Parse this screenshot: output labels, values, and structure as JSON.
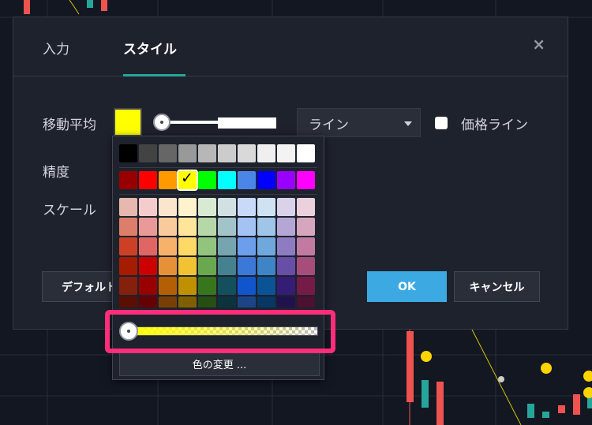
{
  "tabs": [
    {
      "label": "入力"
    },
    {
      "label": "スタイル"
    }
  ],
  "close_label": "×",
  "rows": {
    "moving_average": "移動平均",
    "precision": "精度",
    "scale": "スケール"
  },
  "line_style": {
    "selected": "ライン"
  },
  "price_line": {
    "label": "価格ライン",
    "checked": false
  },
  "buttons": {
    "default": "デフォルト",
    "ok": "OK",
    "cancel": "キャンセル"
  },
  "color_picker": {
    "selected_color": "#ffff00",
    "opacity": 1.0,
    "change_color_label": "色の変更 ...",
    "grays": [
      "#000000",
      "#434343",
      "#666666",
      "#999999",
      "#b7b7b7",
      "#cccccc",
      "#d9d9d9",
      "#efefef",
      "#f3f3f3",
      "#ffffff"
    ],
    "brights": [
      "#980000",
      "#ff0000",
      "#ff9900",
      "#ffff00",
      "#00ff00",
      "#00ffff",
      "#4a86e8",
      "#0000ff",
      "#9900ff",
      "#ff00ff"
    ],
    "shades": [
      [
        "#e6b8af",
        "#f4cccc",
        "#fce5cd",
        "#fff2cc",
        "#d9ead3",
        "#d0e0e3",
        "#c9daf8",
        "#cfe2f3",
        "#d9d2e9",
        "#ead1dc"
      ],
      [
        "#dd7e6b",
        "#ea9999",
        "#f9cb9c",
        "#ffe599",
        "#b6d7a8",
        "#a2c4c9",
        "#a4c2f4",
        "#9fc5e8",
        "#b4a7d6",
        "#d5a6bd"
      ],
      [
        "#cc4125",
        "#e06666",
        "#f6b26b",
        "#ffd966",
        "#93c47d",
        "#76a5af",
        "#6d9eeb",
        "#6fa8dc",
        "#8e7cc3",
        "#c27ba0"
      ],
      [
        "#a61c00",
        "#cc0000",
        "#e69138",
        "#f1c232",
        "#6aa84f",
        "#45818e",
        "#3c78d8",
        "#3d85c6",
        "#674ea7",
        "#a64d79"
      ],
      [
        "#85200c",
        "#990000",
        "#b45f06",
        "#bf9000",
        "#38761d",
        "#134f5c",
        "#1155cc",
        "#0b5394",
        "#351c75",
        "#741b47"
      ],
      [
        "#5b0f00",
        "#660000",
        "#783f04",
        "#7f6000",
        "#274e13",
        "#0c343d",
        "#1c4587",
        "#073763",
        "#20124d",
        "#4c1130"
      ]
    ],
    "selected_index": 3
  },
  "colors": {
    "accent_tab": "#26a69a",
    "ok_button": "#3ca9e2",
    "highlight": "#ff2d7a"
  }
}
